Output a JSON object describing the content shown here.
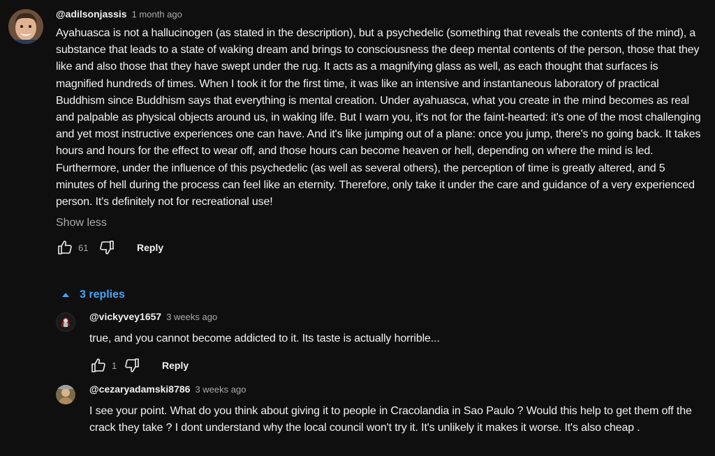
{
  "main_comment": {
    "author": "@adilsonjassis",
    "time": "1 month ago",
    "text": "Ayahuasca is not a hallucinogen (as stated in the description), but a psychedelic (something that reveals the contents of the mind), a substance that leads to a state of waking dream and brings to consciousness the deep mental contents of the person, those that they like and also those that they have swept under the rug. It acts as a magnifying glass as well, as each thought that surfaces is magnified hundreds of times. When I took it for the first time, it was like an intensive and instantaneous laboratory of practical Buddhism since Buddhism says that everything is mental creation. Under ayahuasca, what you create in the mind becomes as real and palpable as physical objects around us, in waking life. But I warn you, it's not for the faint-hearted: it's one of the most challenging and yet most instructive experiences one can have. And it's like jumping out of a plane: once you jump, there's no going back. It takes hours and hours for the effect to wear off, and those hours can become heaven or hell, depending on where the mind is led. Furthermore, under the influence of this psychedelic (as well as several others), the perception of time is greatly altered, and 5 minutes of hell during the process can feel like an eternity. Therefore, only take it under the care and guidance of a very experienced person. It's definitely not for recreational use!",
    "show_less": "Show less",
    "likes": "61",
    "reply_label": "Reply"
  },
  "replies_toggle": {
    "label": "3 replies"
  },
  "replies": [
    {
      "author": "@vickyvey1657",
      "time": "3 weeks ago",
      "text": "true, and you cannot become addicted to it. Its taste is actually horrible...",
      "likes": "1",
      "reply_label": "Reply"
    },
    {
      "author": "@cezaryadamski8786",
      "time": "3 weeks ago",
      "text": "I see your point. What do you think about giving it to people in Cracolandia in Sao Paulo ? Would this help to get them off the crack they take ? I dont understand why the local council won't try it. It's unlikely it makes it worse. It's also cheap ."
    }
  ],
  "colors": {
    "background": "#0f0f0f",
    "text": "#f1f1f1",
    "secondary_text": "#aaaaaa",
    "link_blue": "#3ea6ff"
  },
  "icons": [
    "thumbs-up-icon",
    "thumbs-down-icon",
    "chevron-up-icon"
  ]
}
